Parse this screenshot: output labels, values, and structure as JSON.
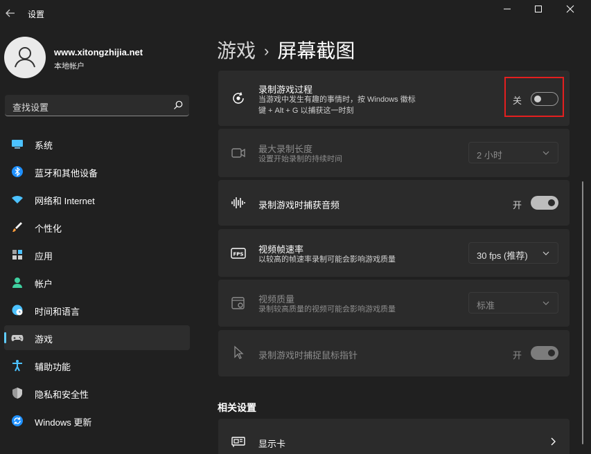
{
  "window": {
    "title": "设置"
  },
  "profile": {
    "site": "www.xitongzhijia.net",
    "account": "本地帐户"
  },
  "search": {
    "placeholder": "查找设置"
  },
  "nav": {
    "items": [
      {
        "label": "系统",
        "icon": "monitor-icon"
      },
      {
        "label": "蓝牙和其他设备",
        "icon": "bluetooth-icon"
      },
      {
        "label": "网络和 Internet",
        "icon": "wifi-icon"
      },
      {
        "label": "个性化",
        "icon": "brush-icon"
      },
      {
        "label": "应用",
        "icon": "apps-icon"
      },
      {
        "label": "帐户",
        "icon": "person-icon"
      },
      {
        "label": "时间和语言",
        "icon": "globe-clock-icon"
      },
      {
        "label": "游戏",
        "icon": "gamepad-icon",
        "active": true
      },
      {
        "label": "辅助功能",
        "icon": "accessibility-icon"
      },
      {
        "label": "隐私和安全性",
        "icon": "shield-icon"
      },
      {
        "label": "Windows 更新",
        "icon": "update-icon"
      }
    ]
  },
  "breadcrumb": {
    "parent": "游戏",
    "separator": "›",
    "current": "屏幕截图"
  },
  "settings": {
    "record_process": {
      "title": "录制游戏过程",
      "subtitle_line1": "当游戏中发生有趣的事情时，按 Windows 徽标",
      "subtitle_line2": "键 + Alt + G 以捕获这一时刻",
      "toggle_label": "关",
      "state": "off"
    },
    "max_length": {
      "title": "最大录制长度",
      "subtitle": "设置开始录制的持续时间",
      "value": "2 小时",
      "disabled": true
    },
    "capture_audio": {
      "title": "录制游戏时捕获音频",
      "toggle_label": "开",
      "state": "on"
    },
    "frame_rate": {
      "title": "视频帧速率",
      "subtitle": "以较高的帧速率录制可能会影响游戏质量",
      "value": "30 fps (推荐)"
    },
    "quality": {
      "title": "视频质量",
      "subtitle": "录制较高质量的视频可能会影响游戏质量",
      "value": "标准",
      "disabled": true
    },
    "mouse_cursor": {
      "title": "录制游戏时捕捉鼠标指针",
      "toggle_label": "开",
      "state": "on",
      "disabled": true
    }
  },
  "related": {
    "heading": "相关设置",
    "display_card": "显示卡"
  },
  "colors": {
    "accent": "#60cdff",
    "highlight": "#e51f1f",
    "background": "#202020",
    "card": "#2b2b2b"
  }
}
